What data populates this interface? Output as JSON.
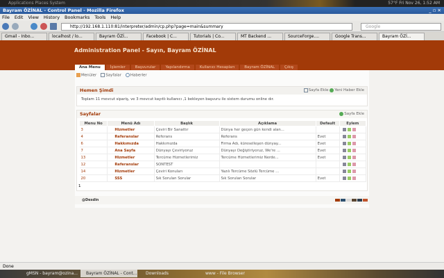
{
  "desktop": {
    "menu": "Applications  Places  System",
    "tray": "57°F  Fri Nov 26, 1:52 AM"
  },
  "window": {
    "title": "Bayram ÖZİNAL - Control Panel - Mozilla Firefox",
    "controls": "_ ▫ ✕"
  },
  "menu": [
    "File",
    "Edit",
    "View",
    "History",
    "Bookmarks",
    "Tools",
    "Help"
  ],
  "url": "http://192.168.1.110:81/interpreter/admin/cp.php?page=main&summary",
  "search_placeholder": "Google",
  "browser_tabs": [
    "Gmail - Inbo...",
    "localhost / lo...",
    "Bayram ÖZİ...",
    "Facebook | C...",
    "Tutorials | Co...",
    "MT Backend ...",
    "SourceForge....",
    "Google Trans...",
    "Bayram ÖZİ..."
  ],
  "page": {
    "title": "Administration Panel - Sayın, Bayram ÖZİNAL",
    "tabs": [
      "Ana Menu",
      "İşlemler",
      "Başvurular",
      "Yapılandırma",
      "Kullanıcı Hesapları",
      "Bayram ÖZİNAL",
      "Çıkış"
    ],
    "submenu": [
      "Menüler",
      "Sayfalar",
      "Haberler"
    ],
    "now": {
      "title": "Hemen Şimdi",
      "actions": [
        "Sayfa Ekle",
        "Yeni Haber Ekle"
      ],
      "text": "Toplam 11 mevcut sipariş, ve 3 mevcut kayıtlı kullanıcı ,1 bekleyen başvuru ile sistem durumu online dır."
    },
    "pages": {
      "title": "Sayfalar",
      "action": "Sayfa Ekle",
      "columns": [
        "Menu No",
        "Menü Adı",
        "Başlık",
        "Açıklama",
        "Default",
        "Eylem"
      ],
      "rows": [
        [
          "3",
          "Hizmetler",
          "Çeviri Bir Sanattır",
          "Dünya her geçen gün kendi alan...",
          ""
        ],
        [
          "4",
          "Referanslar",
          "Referans",
          "Referans",
          "Evet"
        ],
        [
          "6",
          "Hakkımızda",
          "Hakkımızda",
          "Firma Adı, küreselleşen dünyay...",
          "Evet"
        ],
        [
          "7",
          "Ana Sayfa",
          "Dünyayı Çeviriyoruz",
          "Dünyayı Değiştiriyoruz, We're ...",
          "Evet"
        ],
        [
          "13",
          "Hizmetler",
          "Tercüme Hizmetlerimiz",
          "Tercüme Hizmetlerimiz Nerde...",
          "Evet"
        ],
        [
          "12",
          "Referanslar",
          "SONTEST",
          "",
          ""
        ],
        [
          "14",
          "Hizmetler",
          "Çeviri Konuları",
          "Yazılı Tercüme Sözlü Tercüme ...",
          ""
        ],
        [
          "20",
          "SSS",
          "Sık Sorulan Sorular",
          "Sık Sorulan Sorular",
          "Evet"
        ]
      ],
      "pagination": "1"
    },
    "footer_logo": "@Desdin"
  },
  "status": "Done",
  "taskbar": [
    "gMSN - bayram@ozina...",
    "Bayram ÖZİNAL - Cont...",
    "Downloads",
    "www - File Browser"
  ],
  "colors": {
    "brand": "#a23a08",
    "theme_swatches": [
      "#a23a08",
      "#2c4f6e",
      "#d9d9d9",
      "#5a4632",
      "#2f3f4f",
      "#c0532a"
    ]
  }
}
